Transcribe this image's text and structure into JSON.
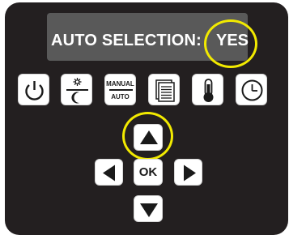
{
  "display": {
    "label": "AUTO SELECTION:",
    "value": "YES"
  },
  "mode_buttons": [
    {
      "name": "power",
      "icon": "power-icon"
    },
    {
      "name": "day-night",
      "icon": "sun-moon-icon"
    },
    {
      "name": "manual-auto",
      "icon": "manual-auto-icon",
      "top_text": "MANUAL",
      "bottom_text": "AUTO"
    },
    {
      "name": "menu",
      "icon": "document-icon"
    },
    {
      "name": "temperature",
      "icon": "thermometer-icon"
    },
    {
      "name": "timer",
      "icon": "clock-icon"
    }
  ],
  "nav": {
    "ok_label": "OK"
  },
  "colors": {
    "panel": "#231f20",
    "screen": "#595959",
    "highlight": "#f2ea00",
    "button": "#ffffff"
  }
}
